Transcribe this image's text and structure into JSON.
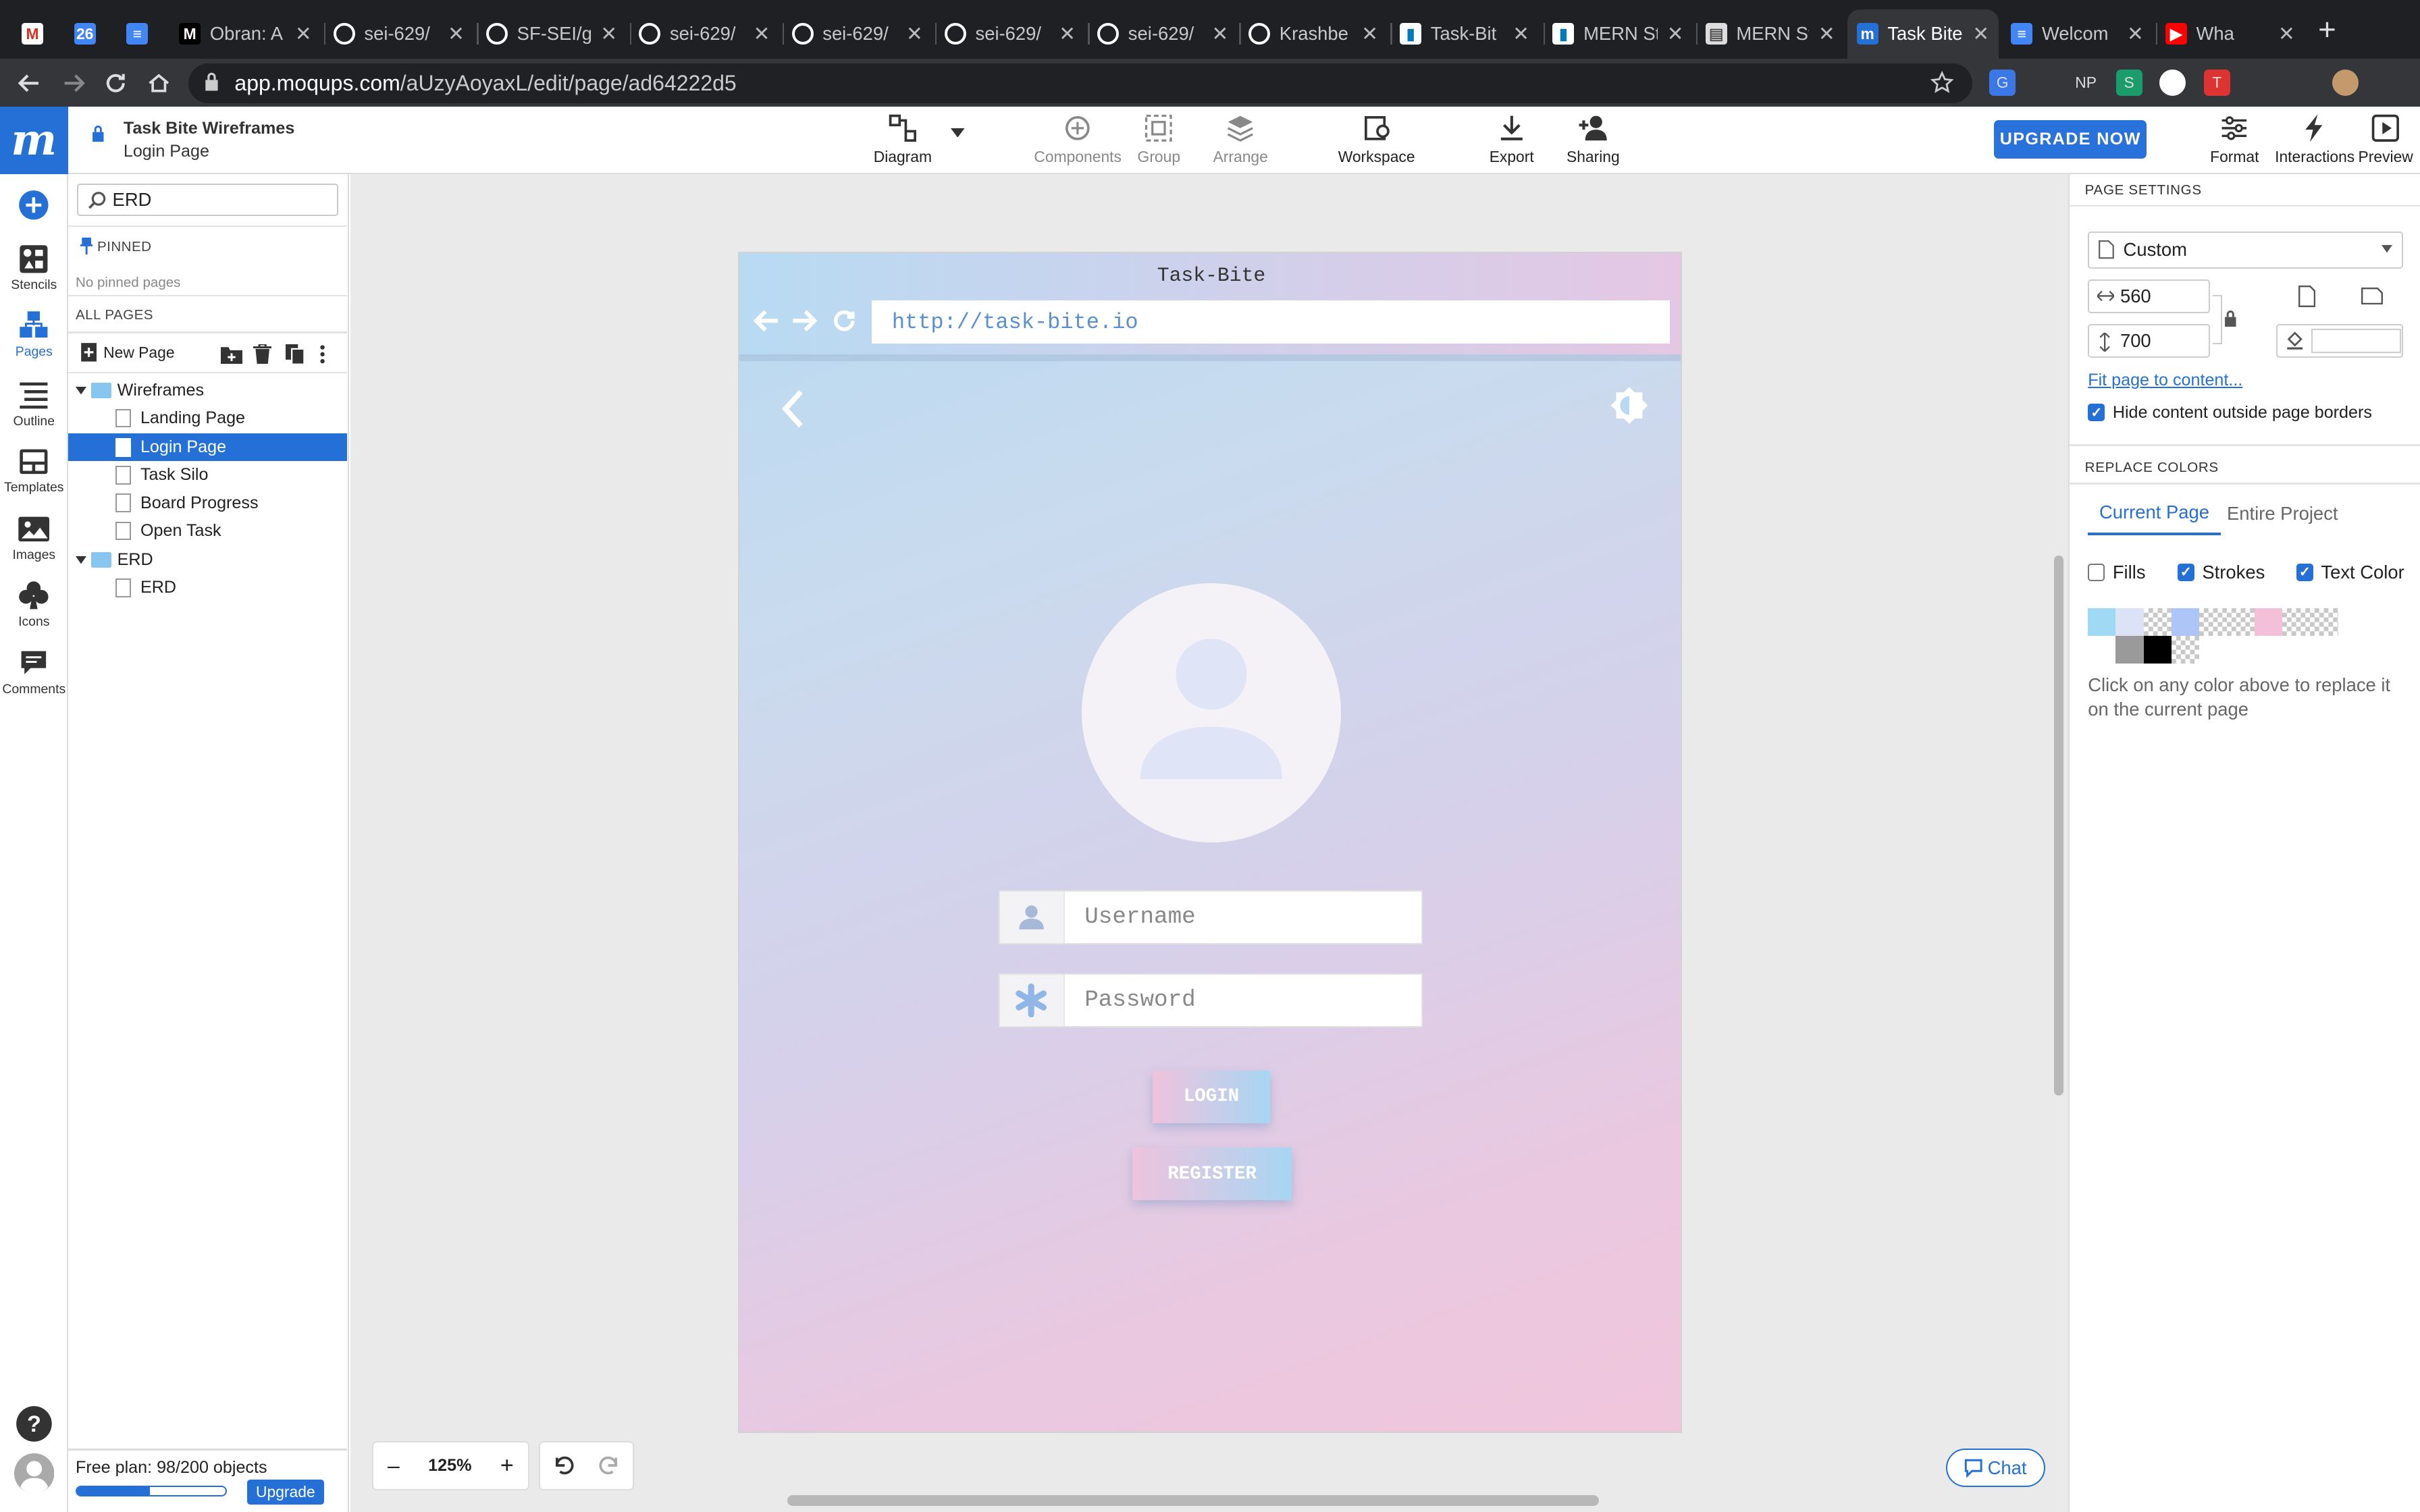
{
  "browser": {
    "tabs": [
      {
        "title": "",
        "icon": "gmail-icon"
      },
      {
        "title": "",
        "icon": "calendar-icon"
      },
      {
        "title": "",
        "icon": "docs-icon"
      },
      {
        "title": "Obran: A",
        "icon": "medium-icon"
      },
      {
        "title": "sei-629/",
        "icon": "github-icon"
      },
      {
        "title": "SF-SEI/g",
        "icon": "github-icon"
      },
      {
        "title": "sei-629/",
        "icon": "github-icon"
      },
      {
        "title": "sei-629/",
        "icon": "github-icon"
      },
      {
        "title": "sei-629/",
        "icon": "github-icon"
      },
      {
        "title": "sei-629/",
        "icon": "github-icon"
      },
      {
        "title": "Krashbe",
        "icon": "github-icon"
      },
      {
        "title": "Task-Bit",
        "icon": "trello-icon"
      },
      {
        "title": "MERN St",
        "icon": "trello-icon"
      },
      {
        "title": "MERN St",
        "icon": "page-icon"
      },
      {
        "title": "Task Bite",
        "icon": "moqups-icon",
        "active": true
      },
      {
        "title": "Welcom",
        "icon": "docs-icon"
      },
      {
        "title": "Wha",
        "icon": "youtube-icon"
      }
    ],
    "url_host": "app.moqups.com",
    "url_path": "/aUzyAoyaxL/edit/page/ad64222d5",
    "extensions": [
      "G",
      "",
      "NP",
      "S",
      "",
      "T",
      "",
      "",
      ""
    ]
  },
  "header": {
    "logo": "m",
    "project": "Task Bite Wireframes",
    "page": "Login Page",
    "tools": {
      "diagram": "Diagram",
      "components": "Components",
      "group": "Group",
      "arrange": "Arrange",
      "workspace": "Workspace",
      "export": "Export",
      "sharing": "Sharing"
    },
    "upgrade": "UPGRADE NOW",
    "right_tools": {
      "format": "Format",
      "interactions": "Interactions",
      "preview": "Preview"
    }
  },
  "rail": {
    "stencils": "Stencils",
    "pages": "Pages",
    "outline": "Outline",
    "templates": "Templates",
    "images": "Images",
    "icons": "Icons",
    "comments": "Comments"
  },
  "pages_panel": {
    "search_value": "ERD",
    "pinned_title": "PINNED",
    "pinned_empty": "No pinned pages",
    "all_title": "ALL PAGES",
    "new_page": "New Page",
    "folder1": "Wireframes",
    "folder1_items": [
      "Landing Page",
      "Login Page",
      "Task Silo",
      "Board Progress",
      "Open Task"
    ],
    "folder2": "ERD",
    "folder2_items": [
      "ERD"
    ],
    "plan": "Free plan: 98/200 objects",
    "plan_progress": 0.49,
    "upgrade": "Upgrade"
  },
  "artboard": {
    "title": "Task-Bite",
    "url": "http://task-bite.io",
    "username_placeholder": "Username",
    "password_placeholder": "Password",
    "login": "LOGIN",
    "register": "REGISTER"
  },
  "page_settings": {
    "title": "PAGE SETTINGS",
    "preset": "Custom",
    "width": "560",
    "height": "700",
    "fit_link": "Fit page to content...",
    "hide_outside": "Hide content outside page borders",
    "hide_outside_checked": true
  },
  "replace_colors": {
    "title": "REPLACE COLORS",
    "tab_current": "Current Page",
    "tab_entire": "Entire Project",
    "fills": "Fills",
    "fills_checked": false,
    "strokes": "Strokes",
    "strokes_checked": true,
    "text_color": "Text Color",
    "text_color_checked": true,
    "swatches_row1": [
      "#9fd9f4",
      "#dde3f7",
      "checker",
      "#aec6f7",
      "checker",
      "checker",
      "#f4bfd9",
      "checker",
      "checker",
      "#ffffff"
    ],
    "swatches_row2": [
      "#ffffff",
      "#9a9a9a",
      "#000000",
      "checker"
    ],
    "hint": "Click on any color above to replace it on the current page"
  },
  "zoom": {
    "minus": "–",
    "value": "125%",
    "plus": "+"
  },
  "chat": "Chat",
  "colors": {
    "accent": "#2570d6",
    "tab_bg": "#1f2023",
    "addr_bg": "#35363a"
  }
}
